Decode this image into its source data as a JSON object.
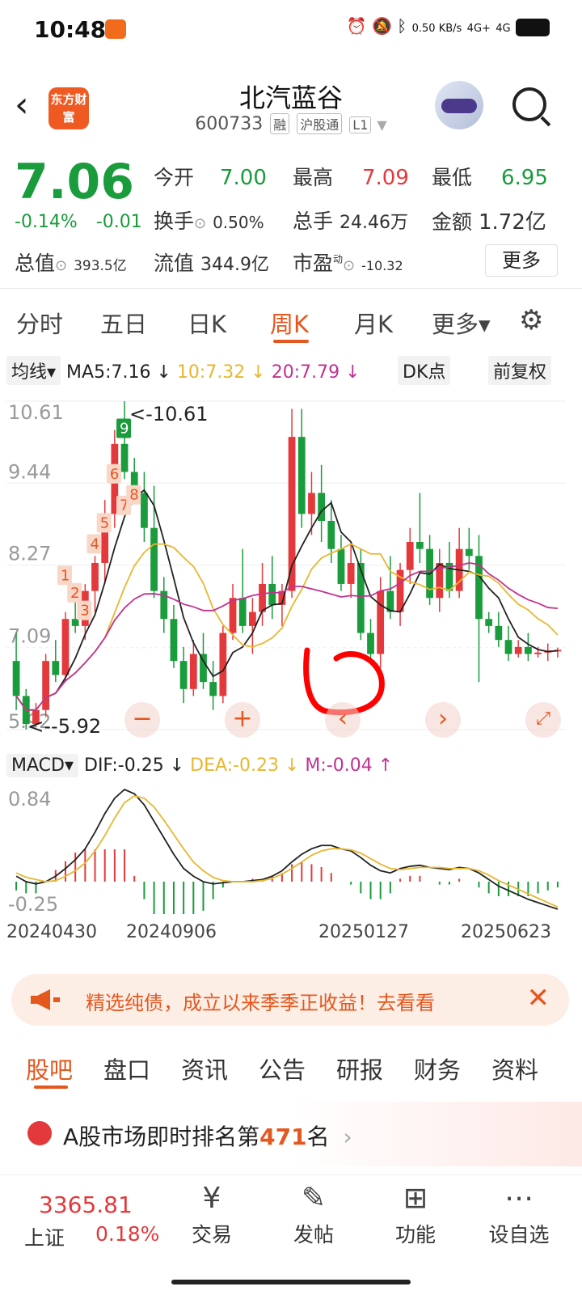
{
  "status": {
    "time": "10:48",
    "net_speed": "0.50 KB/s",
    "signal1": "4G+",
    "signal2": "4G"
  },
  "header": {
    "back": "‹",
    "logo_text": "东方财富",
    "title": "北汽蓝谷",
    "code": "600733",
    "tag1": "融",
    "tag2": "沪股通",
    "tag3": "L1"
  },
  "quote": {
    "price": "7.06",
    "change_pct": "-0.14%",
    "change": "-0.01",
    "open_label": "今开",
    "open": "7.00",
    "high_label": "最高",
    "high": "7.09",
    "low_label": "最低",
    "low": "6.95",
    "turnover_label": "换手",
    "turnover": "0.50%",
    "volume_label": "总手",
    "volume": "24.46万",
    "amount_label": "金额",
    "amount": "1.72亿",
    "mktcap_label": "总值",
    "mktcap": "393.5亿",
    "float_label": "流值",
    "float": "344.9亿",
    "pe_label": "市盈",
    "pe_sup": "动",
    "pe": "-10.32",
    "more": "更多"
  },
  "tabs": [
    {
      "label": "分时"
    },
    {
      "label": "五日"
    },
    {
      "label": "日K"
    },
    {
      "label": "周K"
    },
    {
      "label": "月K"
    },
    {
      "label": "更多▾"
    }
  ],
  "ma": {
    "selector": "均线▾",
    "ma5": "MA5:7.16 ↓",
    "ma10": "10:7.32 ↓",
    "ma20": "20:7.79 ↓",
    "dk": "DK点",
    "adjust": "前复权"
  },
  "kline": {
    "y_labels": [
      "10.61",
      "9.44",
      "8.27",
      "7.09",
      "5.92"
    ],
    "max_note": "<-10.61",
    "min_note": "<--5.92",
    "td_marks": [
      "1",
      "2",
      "3",
      "4",
      "5",
      "6",
      "7",
      "8",
      "9"
    ]
  },
  "macd": {
    "selector": "MACD▾",
    "dif": "DIF:-0.25 ↓",
    "dea": "DEA:-0.23 ↓",
    "m": "M:-0.04 ↑",
    "y_top": "0.84",
    "y_bottom": "-0.25"
  },
  "x_labels": [
    "20240430",
    "20240906",
    "20250127",
    "20250623"
  ],
  "banner": {
    "text": "精选纯债，成立以来季季正收益！去看看",
    "close": "✕"
  },
  "bottom_tabs": [
    {
      "label": "股吧"
    },
    {
      "label": "盘口"
    },
    {
      "label": "资讯"
    },
    {
      "label": "公告"
    },
    {
      "label": "研报"
    },
    {
      "label": "财务"
    },
    {
      "label": "资料"
    }
  ],
  "rank": {
    "prefix": "A股市场即时排名第",
    "number": "471",
    "suffix": "名",
    "arrow": "›"
  },
  "index": {
    "value": "3365.81",
    "name": "上证",
    "change": "0.18%"
  },
  "nav": [
    {
      "label": "交易",
      "icon": "¥"
    },
    {
      "label": "发帖",
      "icon": "✎"
    },
    {
      "label": "功能",
      "icon": "⊞"
    },
    {
      "label": "设自选",
      "icon": "⋯"
    }
  ],
  "colors": {
    "up": "#e4393c",
    "down": "#1a9b3c",
    "accent": "#e4571f",
    "ma10": "#e8b630",
    "ma20": "#c03290"
  },
  "chart_data": {
    "type": "candlestick",
    "period": "weekly",
    "ylim": [
      5.92,
      10.61
    ],
    "y_ticks": [
      10.61,
      9.44,
      8.27,
      7.09,
      5.92
    ],
    "max": 10.61,
    "min": 5.92,
    "candles": [
      {
        "o": 6.9,
        "h": 7.3,
        "l": 6.2,
        "c": 6.4
      },
      {
        "o": 6.4,
        "h": 6.5,
        "l": 5.92,
        "c": 6.0
      },
      {
        "o": 6.0,
        "h": 6.3,
        "l": 5.95,
        "c": 6.2
      },
      {
        "o": 6.2,
        "h": 7.0,
        "l": 6.1,
        "c": 6.9
      },
      {
        "o": 6.9,
        "h": 7.2,
        "l": 6.6,
        "c": 6.7
      },
      {
        "o": 6.7,
        "h": 7.6,
        "l": 6.6,
        "c": 7.5
      },
      {
        "o": 7.5,
        "h": 7.8,
        "l": 7.3,
        "c": 7.4
      },
      {
        "o": 7.4,
        "h": 8.0,
        "l": 7.2,
        "c": 7.9
      },
      {
        "o": 7.9,
        "h": 8.4,
        "l": 7.6,
        "c": 8.3
      },
      {
        "o": 8.3,
        "h": 9.2,
        "l": 8.0,
        "c": 9.0
      },
      {
        "o": 9.0,
        "h": 10.2,
        "l": 8.8,
        "c": 10.0
      },
      {
        "o": 10.0,
        "h": 10.61,
        "l": 9.5,
        "c": 9.6
      },
      {
        "o": 9.6,
        "h": 9.8,
        "l": 9.2,
        "c": 9.3
      },
      {
        "o": 9.3,
        "h": 9.6,
        "l": 8.6,
        "c": 8.8
      },
      {
        "o": 8.8,
        "h": 9.4,
        "l": 7.8,
        "c": 7.9
      },
      {
        "o": 7.9,
        "h": 8.1,
        "l": 7.3,
        "c": 7.5
      },
      {
        "o": 7.5,
        "h": 7.7,
        "l": 6.8,
        "c": 6.9
      },
      {
        "o": 6.9,
        "h": 7.1,
        "l": 6.3,
        "c": 6.5
      },
      {
        "o": 6.5,
        "h": 7.2,
        "l": 6.4,
        "c": 7.0
      },
      {
        "o": 7.0,
        "h": 7.3,
        "l": 6.5,
        "c": 6.6
      },
      {
        "o": 6.6,
        "h": 6.9,
        "l": 6.2,
        "c": 6.4
      },
      {
        "o": 6.4,
        "h": 7.4,
        "l": 6.3,
        "c": 7.3
      },
      {
        "o": 7.3,
        "h": 8.0,
        "l": 7.2,
        "c": 7.8
      },
      {
        "o": 7.8,
        "h": 8.5,
        "l": 7.3,
        "c": 7.4
      },
      {
        "o": 7.4,
        "h": 7.8,
        "l": 7.0,
        "c": 7.6
      },
      {
        "o": 7.6,
        "h": 8.3,
        "l": 7.4,
        "c": 8.0
      },
      {
        "o": 8.0,
        "h": 8.4,
        "l": 7.5,
        "c": 7.7
      },
      {
        "o": 7.7,
        "h": 8.0,
        "l": 7.4,
        "c": 7.9
      },
      {
        "o": 7.9,
        "h": 10.5,
        "l": 7.8,
        "c": 10.1
      },
      {
        "o": 10.1,
        "h": 10.5,
        "l": 8.8,
        "c": 9.0
      },
      {
        "o": 9.0,
        "h": 9.6,
        "l": 8.7,
        "c": 9.3
      },
      {
        "o": 9.3,
        "h": 9.7,
        "l": 8.6,
        "c": 8.9
      },
      {
        "o": 8.9,
        "h": 9.2,
        "l": 8.3,
        "c": 8.5
      },
      {
        "o": 8.5,
        "h": 8.7,
        "l": 7.9,
        "c": 8.0
      },
      {
        "o": 8.0,
        "h": 8.6,
        "l": 7.8,
        "c": 8.3
      },
      {
        "o": 8.3,
        "h": 8.5,
        "l": 7.2,
        "c": 7.3
      },
      {
        "o": 7.3,
        "h": 7.5,
        "l": 6.9,
        "c": 7.0
      },
      {
        "o": 7.0,
        "h": 8.1,
        "l": 6.8,
        "c": 7.9
      },
      {
        "o": 7.9,
        "h": 8.4,
        "l": 7.5,
        "c": 7.6
      },
      {
        "o": 7.6,
        "h": 8.3,
        "l": 7.4,
        "c": 8.2
      },
      {
        "o": 8.2,
        "h": 8.8,
        "l": 8.0,
        "c": 8.6
      },
      {
        "o": 8.6,
        "h": 9.3,
        "l": 8.3,
        "c": 8.5
      },
      {
        "o": 8.5,
        "h": 8.7,
        "l": 7.7,
        "c": 7.8
      },
      {
        "o": 7.8,
        "h": 8.5,
        "l": 7.6,
        "c": 8.3
      },
      {
        "o": 8.3,
        "h": 8.6,
        "l": 7.8,
        "c": 7.9
      },
      {
        "o": 7.9,
        "h": 8.8,
        "l": 7.8,
        "c": 8.5
      },
      {
        "o": 8.5,
        "h": 8.8,
        "l": 8.2,
        "c": 8.4
      },
      {
        "o": 8.4,
        "h": 8.7,
        "l": 6.6,
        "c": 7.5
      },
      {
        "o": 7.5,
        "h": 7.6,
        "l": 7.3,
        "c": 7.4
      },
      {
        "o": 7.4,
        "h": 7.6,
        "l": 7.1,
        "c": 7.2
      },
      {
        "o": 7.2,
        "h": 7.4,
        "l": 6.9,
        "c": 7.0
      },
      {
        "o": 7.0,
        "h": 7.2,
        "l": 6.95,
        "c": 7.1
      },
      {
        "o": 7.1,
        "h": 7.3,
        "l": 6.9,
        "c": 7.0
      },
      {
        "o": 7.0,
        "h": 7.1,
        "l": 6.95,
        "c": 7.02
      },
      {
        "o": 7.02,
        "h": 7.15,
        "l": 6.9,
        "c": 7.05
      },
      {
        "o": 7.05,
        "h": 7.09,
        "l": 6.95,
        "c": 7.06
      }
    ],
    "macd_ylim": [
      -0.25,
      0.84
    ],
    "dif": [
      0.05,
      0.0,
      -0.02,
      0.0,
      0.05,
      0.12,
      0.2,
      0.3,
      0.45,
      0.62,
      0.76,
      0.84,
      0.8,
      0.7,
      0.55,
      0.4,
      0.25,
      0.12,
      0.05,
      0.0,
      -0.02,
      -0.01,
      0.0,
      0.0,
      0.01,
      0.02,
      0.05,
      0.1,
      0.18,
      0.25,
      0.3,
      0.33,
      0.33,
      0.3,
      0.28,
      0.22,
      0.15,
      0.1,
      0.08,
      0.12,
      0.14,
      0.15,
      0.13,
      0.12,
      0.11,
      0.13,
      0.12,
      0.08,
      0.02,
      -0.04,
      -0.08,
      -0.12,
      -0.16,
      -0.19,
      -0.22,
      -0.25
    ],
    "dea": [
      0.08,
      0.04,
      0.02,
      0.0,
      0.01,
      0.05,
      0.1,
      0.17,
      0.28,
      0.42,
      0.58,
      0.72,
      0.78,
      0.76,
      0.68,
      0.56,
      0.43,
      0.3,
      0.18,
      0.1,
      0.04,
      0.01,
      0.0,
      0.0,
      0.0,
      0.01,
      0.03,
      0.07,
      0.12,
      0.18,
      0.24,
      0.28,
      0.3,
      0.3,
      0.29,
      0.26,
      0.21,
      0.16,
      0.12,
      0.11,
      0.12,
      0.13,
      0.13,
      0.13,
      0.12,
      0.12,
      0.12,
      0.1,
      0.06,
      0.01,
      -0.03,
      -0.07,
      -0.11,
      -0.15,
      -0.19,
      -0.23
    ],
    "x_ticks": [
      "20240430",
      "20240906",
      "20250127",
      "20250623"
    ]
  }
}
